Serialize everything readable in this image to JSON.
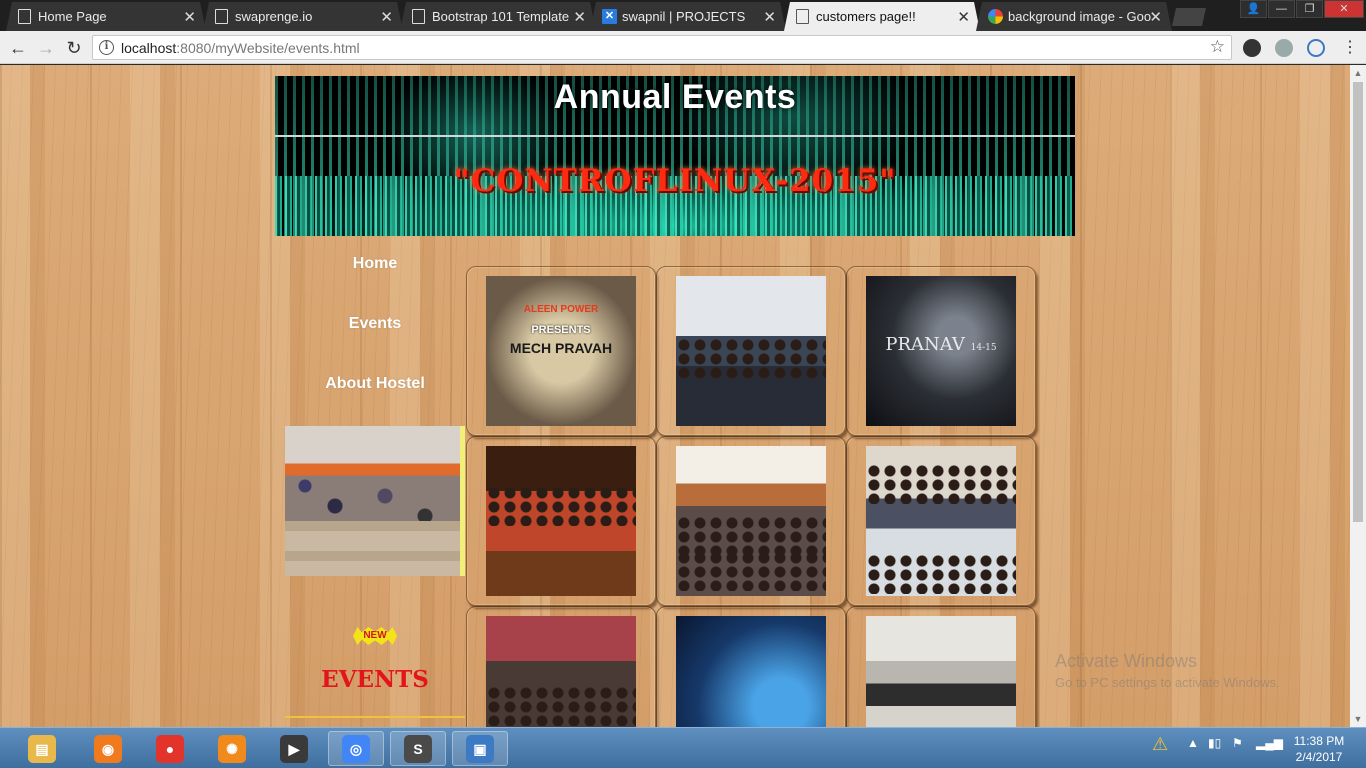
{
  "browser": {
    "tabs": [
      {
        "label": "Home Page",
        "icon": "page-icon",
        "active": false
      },
      {
        "label": "swaprenge.io",
        "icon": "page-icon",
        "active": false
      },
      {
        "label": "Bootstrap 101 Template",
        "icon": "page-icon",
        "active": false
      },
      {
        "label": "swapnil | PROJECTS",
        "icon": "x-logo-icon",
        "active": false
      },
      {
        "label": "customers page!!",
        "icon": "page-icon",
        "active": true
      },
      {
        "label": "background image - Goo",
        "icon": "google-icon",
        "active": false
      }
    ],
    "url_host": "localhost",
    "url_rest": ":8080/myWebsite/events.html"
  },
  "page": {
    "banner_title": "Annual Events",
    "banner_subtitle": "\"CONTROFLINUX-2015\"",
    "nav": [
      {
        "label": "Home"
      },
      {
        "label": "Events"
      },
      {
        "label": "About Hostel"
      }
    ],
    "new_badge": "NEW",
    "side_events": "EVENTS",
    "poster_mech": {
      "line1": "ALEEN POWER",
      "line2": "PRESENTS",
      "line3": "MECH PRAVAH"
    },
    "poster_pranav": {
      "title": "PRANAV",
      "suffix": "14-15"
    }
  },
  "os": {
    "watermark_title": "Activate Windows",
    "watermark_sub": "Go to PC settings to activate Windows.",
    "taskbar_apps": [
      {
        "name": "file-explorer-icon",
        "color": "#e9b84a",
        "open": false
      },
      {
        "name": "uc-browser-icon",
        "color": "#f07b1e",
        "open": false
      },
      {
        "name": "screen-recorder-icon",
        "color": "#e2342a",
        "open": false
      },
      {
        "name": "helm-app-icon",
        "color": "#f08a1c",
        "open": false
      },
      {
        "name": "media-player-icon",
        "color": "#3a3a3a",
        "open": false
      },
      {
        "name": "chrome-icon",
        "color": "#4285f4",
        "open": true
      },
      {
        "name": "sublime-text-icon",
        "color": "#4a4a4a",
        "open": true
      },
      {
        "name": "photo-viewer-icon",
        "color": "#3c7bc4",
        "open": true
      }
    ],
    "time": "11:38 PM",
    "date": "2/4/2017"
  }
}
